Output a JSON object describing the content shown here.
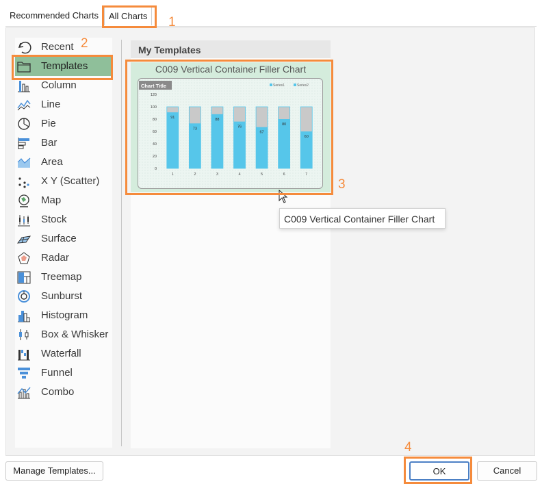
{
  "tabs": {
    "recommended": "Recommended Charts",
    "all": "All Charts"
  },
  "categories": [
    {
      "label": "Recent",
      "icon": "recent-icon"
    },
    {
      "label": "Templates",
      "icon": "folder-icon"
    },
    {
      "label": "Column",
      "icon": "column-chart-icon"
    },
    {
      "label": "Line",
      "icon": "line-chart-icon"
    },
    {
      "label": "Pie",
      "icon": "pie-chart-icon"
    },
    {
      "label": "Bar",
      "icon": "bar-chart-icon"
    },
    {
      "label": "Area",
      "icon": "area-chart-icon"
    },
    {
      "label": "X Y (Scatter)",
      "icon": "scatter-chart-icon"
    },
    {
      "label": "Map",
      "icon": "map-chart-icon"
    },
    {
      "label": "Stock",
      "icon": "stock-chart-icon"
    },
    {
      "label": "Surface",
      "icon": "surface-chart-icon"
    },
    {
      "label": "Radar",
      "icon": "radar-chart-icon"
    },
    {
      "label": "Treemap",
      "icon": "treemap-chart-icon"
    },
    {
      "label": "Sunburst",
      "icon": "sunburst-chart-icon"
    },
    {
      "label": "Histogram",
      "icon": "histogram-chart-icon"
    },
    {
      "label": "Box & Whisker",
      "icon": "box-whisker-chart-icon"
    },
    {
      "label": "Waterfall",
      "icon": "waterfall-chart-icon"
    },
    {
      "label": "Funnel",
      "icon": "funnel-chart-icon"
    },
    {
      "label": "Combo",
      "icon": "combo-chart-icon"
    }
  ],
  "selected_category": "Templates",
  "templates_pane": {
    "header": "My Templates",
    "template_name": "C009 Vertical Container Filler Chart",
    "tooltip": "C009 Vertical Container Filler Chart"
  },
  "chart_data": {
    "type": "bar",
    "title": "Chart Title",
    "categories": [
      "1",
      "2",
      "3",
      "4",
      "5",
      "6",
      "7"
    ],
    "series": [
      {
        "name": "Series1",
        "values": [
          91,
          73,
          88,
          76,
          67,
          80,
          60
        ]
      },
      {
        "name": "Series2",
        "values": [
          100,
          100,
          100,
          100,
          100,
          100,
          100
        ]
      }
    ],
    "yticks": [
      "0",
      "20",
      "40",
      "60",
      "80",
      "100",
      "120"
    ],
    "ylim": [
      0,
      120
    ],
    "grid": false,
    "legend_position": "top-right",
    "data_labels": [
      "91",
      "73",
      "88",
      "76",
      "67",
      "80",
      "60"
    ]
  },
  "buttons": {
    "manage": "Manage Templates...",
    "ok": "OK",
    "cancel": "Cancel"
  },
  "callouts": [
    "1",
    "2",
    "3",
    "4"
  ],
  "colors": {
    "accent_highlight": "#f58b3c",
    "series1": "#56c6ea",
    "series2": "#c9c9c9",
    "selected_category": "#8fbf9a",
    "template_card": "#d4ecdc"
  }
}
